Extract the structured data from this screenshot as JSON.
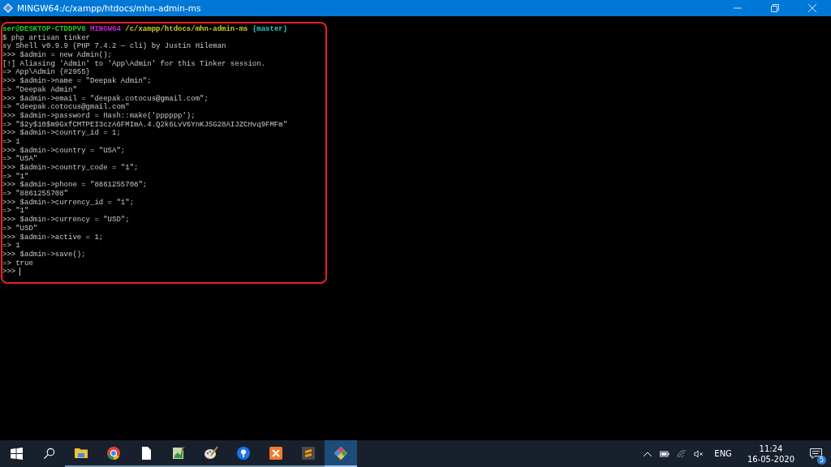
{
  "window": {
    "title": "MINGW64:/c/xampp/htdocs/mhn-admin-ms"
  },
  "terminal": {
    "lines": [
      {
        "spans": [
          {
            "text": "ser@DESKTOP-CTDDPV6",
            "color": "#22cc22"
          },
          {
            "text": " MINGW64",
            "color": "#cc22cc"
          },
          {
            "text": " /c/xampp/htdocs/mhn-admin-ms",
            "color": "#cccc22"
          },
          {
            "text": " (master)",
            "color": "#22cccc"
          }
        ]
      },
      {
        "spans": [
          {
            "text": "$ php artisan tinker"
          }
        ]
      },
      {
        "spans": [
          {
            "text": "sy Shell v0.9.9 (PHP 7.4.2 — cli) by Justin Hileman"
          }
        ]
      },
      {
        "spans": [
          {
            "text": ">>> $admin = new Admin();"
          }
        ]
      },
      {
        "spans": [
          {
            "text": "[!] Aliasing 'Admin' to 'App\\Admin' for this Tinker session."
          }
        ]
      },
      {
        "spans": [
          {
            "text": "=> App\\Admin {#2955}"
          }
        ]
      },
      {
        "spans": [
          {
            "text": ">>> $admin->name = \"Deepak Admin\";"
          }
        ]
      },
      {
        "spans": [
          {
            "text": "=> \"Deepak Admin\""
          }
        ]
      },
      {
        "spans": [
          {
            "text": ">>> $admin->email = \"deepak.cotocus@gmail.com\";"
          }
        ]
      },
      {
        "spans": [
          {
            "text": "=> \"deepak.cotocus@gmail.com\""
          }
        ]
      },
      {
        "spans": [
          {
            "text": ">>> $admin->password = Hash::make('pppppp');"
          }
        ]
      },
      {
        "spans": [
          {
            "text": "=> \"$2y$10$m9GxfCMTPEI3czA6FMImA.4.Q2k6LvV6YnKJSG28AIJZCHvq9FMFm\""
          }
        ]
      },
      {
        "spans": [
          {
            "text": ">>> $admin->country_id = 1;"
          }
        ]
      },
      {
        "spans": [
          {
            "text": "=> 1"
          }
        ]
      },
      {
        "spans": [
          {
            "text": ">>> $admin->country = \"USA\";"
          }
        ]
      },
      {
        "spans": [
          {
            "text": "=> \"USA\""
          }
        ]
      },
      {
        "spans": [
          {
            "text": ">>> $admin->country_code = \"1\";"
          }
        ]
      },
      {
        "spans": [
          {
            "text": "=> \"1\""
          }
        ]
      },
      {
        "spans": [
          {
            "text": ">>> $admin->phone = \"8861255708\";"
          }
        ]
      },
      {
        "spans": [
          {
            "text": "=> \"8861255708\""
          }
        ]
      },
      {
        "spans": [
          {
            "text": ">>> $admin->currency_id = \"1\";"
          }
        ]
      },
      {
        "spans": [
          {
            "text": "=> \"1\""
          }
        ]
      },
      {
        "spans": [
          {
            "text": ">>> $admin->currency = \"USD\";"
          }
        ]
      },
      {
        "spans": [
          {
            "text": "=> \"USD\""
          }
        ]
      },
      {
        "spans": [
          {
            "text": ">>> $admin->active = 1;"
          }
        ]
      },
      {
        "spans": [
          {
            "text": "=> 1"
          }
        ]
      },
      {
        "spans": [
          {
            "text": ">>> $admin->save();"
          }
        ]
      },
      {
        "spans": [
          {
            "text": "=> true"
          }
        ]
      },
      {
        "spans": [
          {
            "text": ">>>"
          }
        ],
        "cursor": true
      }
    ]
  },
  "taskbar": {
    "apps": [
      {
        "kind": "folder",
        "selected": false
      },
      {
        "kind": "chrome",
        "selected": false
      },
      {
        "kind": "file",
        "selected": false
      },
      {
        "kind": "notepad",
        "selected": false
      },
      {
        "kind": "paint",
        "selected": false
      },
      {
        "kind": "pin",
        "selected": false
      },
      {
        "kind": "xampp",
        "selected": false
      },
      {
        "kind": "sublime",
        "selected": false
      },
      {
        "kind": "git",
        "selected": true
      }
    ],
    "tray": {
      "language": "ENG",
      "time": "11:24",
      "date": "16-05-2020",
      "notification_count": "5"
    }
  }
}
